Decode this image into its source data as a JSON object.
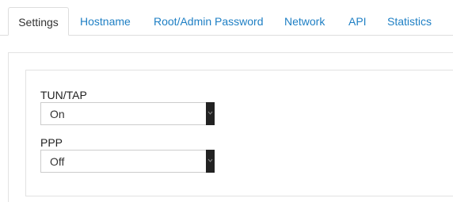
{
  "tabs": [
    {
      "label": "Settings",
      "active": true
    },
    {
      "label": "Hostname",
      "active": false
    },
    {
      "label": "Root/Admin Password",
      "active": false
    },
    {
      "label": "Network",
      "active": false
    },
    {
      "label": "API",
      "active": false
    },
    {
      "label": "Statistics",
      "active": false
    }
  ],
  "settings": {
    "tuntap": {
      "label": "TUN/TAP",
      "value": "On"
    },
    "ppp": {
      "label": "PPP",
      "value": "Off"
    }
  },
  "colors": {
    "link": "#1e7fc4",
    "border": "#dddddd",
    "select_arrow_bg": "#222222"
  },
  "icons": {
    "select_arrow": "chevron-down-icon"
  }
}
